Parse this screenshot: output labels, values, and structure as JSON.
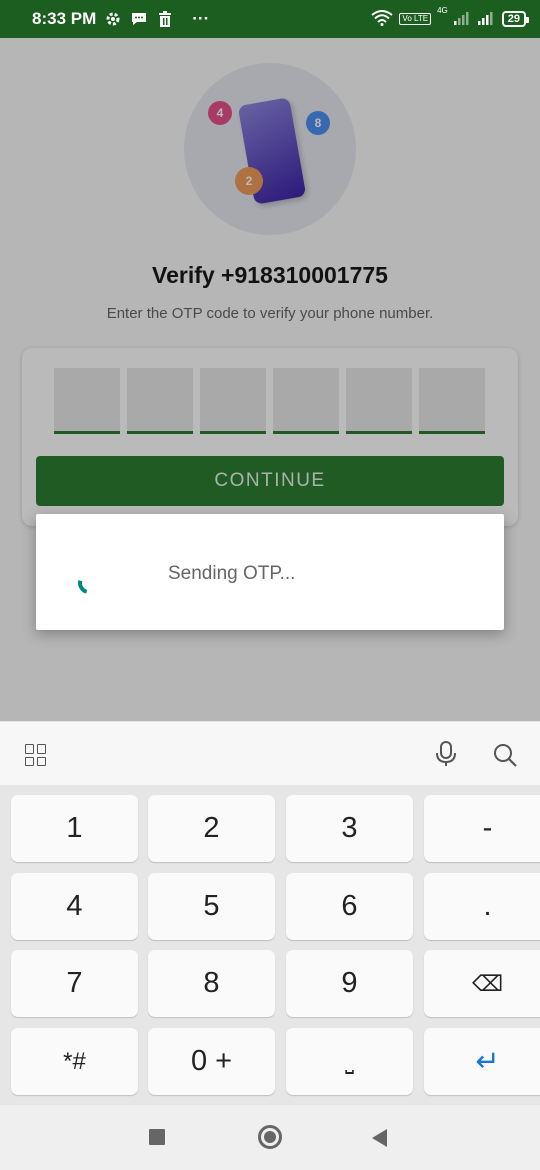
{
  "status_bar": {
    "time": "8:33 PM",
    "more": "···",
    "network": "4G",
    "volte": "Vo LTE",
    "battery": "29",
    "icons": [
      "gear-icon",
      "message-icon",
      "trash-icon",
      "wifi-icon",
      "signal-icon"
    ]
  },
  "illustration": {
    "bubbles": [
      "4",
      "8",
      "2"
    ]
  },
  "verify": {
    "title": "Verify +918310001775",
    "subtitle": "Enter the OTP code to verify your phone number."
  },
  "otp": {
    "digits": [
      "",
      "",
      "",
      "",
      "",
      ""
    ]
  },
  "continue_label": "CONTINUE",
  "dialog": {
    "text": "Sending OTP..."
  },
  "keyboard": {
    "toolbar_icons": [
      "grid-icon",
      "mic-icon",
      "search-icon"
    ],
    "keys": {
      "k1": "1",
      "k2": "2",
      "k3": "3",
      "dash": "-",
      "k4": "4",
      "k5": "5",
      "k6": "6",
      "dot": ".",
      "k7": "7",
      "k8": "8",
      "k9": "9",
      "backspace": "⌫",
      "symbols": "*#",
      "zero": "0 +",
      "space": "⎵",
      "enter": "↵"
    }
  },
  "nav": {
    "icons": [
      "recents-icon",
      "home-icon",
      "back-icon"
    ]
  }
}
